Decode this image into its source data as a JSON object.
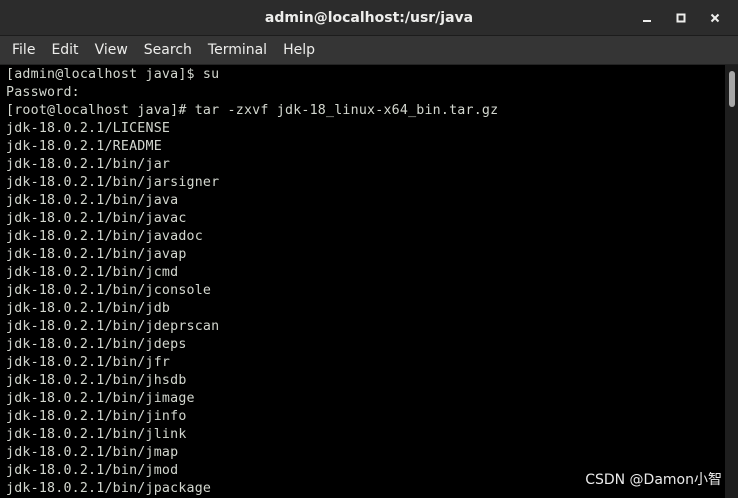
{
  "window": {
    "title": "admin@localhost:/usr/java"
  },
  "menu": {
    "items": [
      "File",
      "Edit",
      "View",
      "Search",
      "Terminal",
      "Help"
    ]
  },
  "terminal": {
    "lines": [
      "[admin@localhost java]$ su",
      "Password:",
      "[root@localhost java]# tar -zxvf jdk-18_linux-x64_bin.tar.gz",
      "jdk-18.0.2.1/LICENSE",
      "jdk-18.0.2.1/README",
      "jdk-18.0.2.1/bin/jar",
      "jdk-18.0.2.1/bin/jarsigner",
      "jdk-18.0.2.1/bin/java",
      "jdk-18.0.2.1/bin/javac",
      "jdk-18.0.2.1/bin/javadoc",
      "jdk-18.0.2.1/bin/javap",
      "jdk-18.0.2.1/bin/jcmd",
      "jdk-18.0.2.1/bin/jconsole",
      "jdk-18.0.2.1/bin/jdb",
      "jdk-18.0.2.1/bin/jdeprscan",
      "jdk-18.0.2.1/bin/jdeps",
      "jdk-18.0.2.1/bin/jfr",
      "jdk-18.0.2.1/bin/jhsdb",
      "jdk-18.0.2.1/bin/jimage",
      "jdk-18.0.2.1/bin/jinfo",
      "jdk-18.0.2.1/bin/jlink",
      "jdk-18.0.2.1/bin/jmap",
      "jdk-18.0.2.1/bin/jmod",
      "jdk-18.0.2.1/bin/jpackage"
    ]
  },
  "watermark": {
    "text": "CSDN @Damon小智"
  },
  "icons": {
    "minimize": "minimize-icon",
    "maximize": "maximize-icon",
    "close": "close-icon"
  },
  "colors": {
    "titlebar": "#2c2c2c",
    "menubar": "#353535",
    "terminal_bg": "#000000",
    "terminal_fg": "#d3d7cf"
  }
}
